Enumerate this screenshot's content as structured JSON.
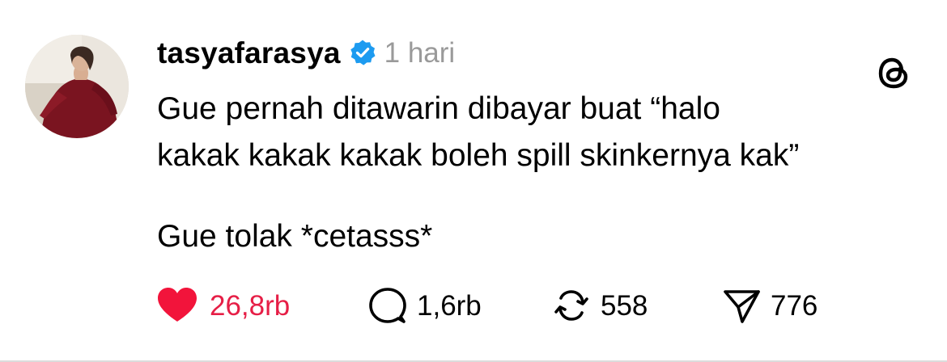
{
  "post": {
    "username": "tasyafarasya",
    "verified": true,
    "timestamp": "1 hari",
    "body_lines": [
      "Gue pernah ditawarin dibayar buat “halo",
      "kakak kakak kakak boleh spill skinkernya kak”",
      "Gue tolak *cetasss*"
    ]
  },
  "actions": {
    "like": {
      "icon": "heart-icon",
      "count": "26,8rb",
      "liked": true,
      "color": "#e61e46"
    },
    "reply": {
      "icon": "speech-bubble-icon",
      "count": "1,6rb"
    },
    "repost": {
      "icon": "repost-icon",
      "count": "558"
    },
    "share": {
      "icon": "paper-plane-icon",
      "count": "776"
    }
  },
  "colors": {
    "verified_blue": "#1d9bf0",
    "timestamp_gray": "#9a9a9a",
    "like_red": "#e61e46"
  },
  "brand": {
    "icon": "threads-logo-icon"
  }
}
